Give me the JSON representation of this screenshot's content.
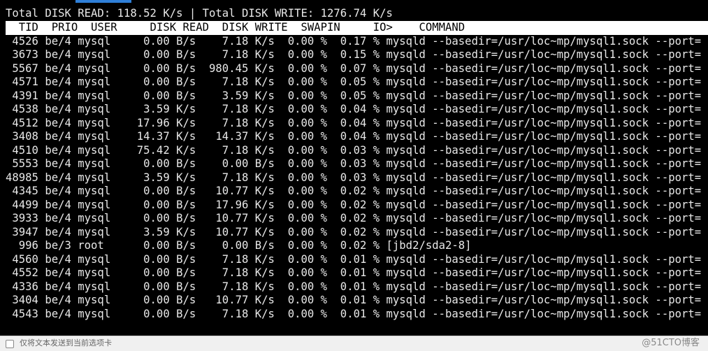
{
  "summary": "Total DISK READ: 118.52 K/s | Total DISK WRITE: 1276.74 K/s",
  "header": "  TID  PRIO  USER     DISK READ  DISK WRITE  SWAPIN     IO>    COMMAND",
  "rows": [
    " 4526 be/4 mysql     0.00 B/s    7.18 K/s  0.00 %  0.17 % mysqld --basedir=/usr/loc~mp/mysql1.sock --port=",
    " 3673 be/4 mysql     0.00 B/s    7.18 K/s  0.00 %  0.15 % mysqld --basedir=/usr/loc~mp/mysql1.sock --port=",
    " 5567 be/4 mysql     0.00 B/s  980.45 K/s  0.00 %  0.07 % mysqld --basedir=/usr/loc~mp/mysql1.sock --port=",
    " 4571 be/4 mysql     0.00 B/s    7.18 K/s  0.00 %  0.05 % mysqld --basedir=/usr/loc~mp/mysql1.sock --port=",
    " 4391 be/4 mysql     0.00 B/s    3.59 K/s  0.00 %  0.05 % mysqld --basedir=/usr/loc~mp/mysql1.sock --port=",
    " 4538 be/4 mysql     3.59 K/s    7.18 K/s  0.00 %  0.04 % mysqld --basedir=/usr/loc~mp/mysql1.sock --port=",
    " 4512 be/4 mysql    17.96 K/s    7.18 K/s  0.00 %  0.04 % mysqld --basedir=/usr/loc~mp/mysql1.sock --port=",
    " 3408 be/4 mysql    14.37 K/s   14.37 K/s  0.00 %  0.04 % mysqld --basedir=/usr/loc~mp/mysql1.sock --port=",
    " 4510 be/4 mysql    75.42 K/s    7.18 K/s  0.00 %  0.03 % mysqld --basedir=/usr/loc~mp/mysql1.sock --port=",
    " 5553 be/4 mysql     0.00 B/s    0.00 B/s  0.00 %  0.03 % mysqld --basedir=/usr/loc~mp/mysql1.sock --port=",
    "48985 be/4 mysql     3.59 K/s    7.18 K/s  0.00 %  0.03 % mysqld --basedir=/usr/loc~mp/mysql1.sock --port=",
    " 4345 be/4 mysql     0.00 B/s   10.77 K/s  0.00 %  0.02 % mysqld --basedir=/usr/loc~mp/mysql1.sock --port=",
    " 4499 be/4 mysql     0.00 B/s   17.96 K/s  0.00 %  0.02 % mysqld --basedir=/usr/loc~mp/mysql1.sock --port=",
    " 3933 be/4 mysql     0.00 B/s   10.77 K/s  0.00 %  0.02 % mysqld --basedir=/usr/loc~mp/mysql1.sock --port=",
    " 3947 be/4 mysql     3.59 K/s   10.77 K/s  0.00 %  0.02 % mysqld --basedir=/usr/loc~mp/mysql1.sock --port=",
    "  996 be/3 root      0.00 B/s    0.00 B/s  0.00 %  0.02 % [jbd2/sda2-8]",
    " 4560 be/4 mysql     0.00 B/s    7.18 K/s  0.00 %  0.01 % mysqld --basedir=/usr/loc~mp/mysql1.sock --port=",
    " 4552 be/4 mysql     0.00 B/s    7.18 K/s  0.00 %  0.01 % mysqld --basedir=/usr/loc~mp/mysql1.sock --port=",
    " 4336 be/4 mysql     0.00 B/s    7.18 K/s  0.00 %  0.01 % mysqld --basedir=/usr/loc~mp/mysql1.sock --port=",
    " 3404 be/4 mysql     0.00 B/s   10.77 K/s  0.00 %  0.01 % mysqld --basedir=/usr/loc~mp/mysql1.sock --port=",
    " 4543 be/4 mysql     0.00 B/s    7.18 K/s  0.00 %  0.01 % mysqld --basedir=/usr/loc~mp/mysql1.sock --port="
  ],
  "status_bar": {
    "text": "仅将文本发送到当前选项卡",
    "icon": "send-icon"
  },
  "watermark": "@51CTO博客",
  "colors": {
    "terminal_bg": "#000000",
    "terminal_fg": "#e8e8e8",
    "header_bg": "#ffffff",
    "header_fg": "#000000"
  }
}
